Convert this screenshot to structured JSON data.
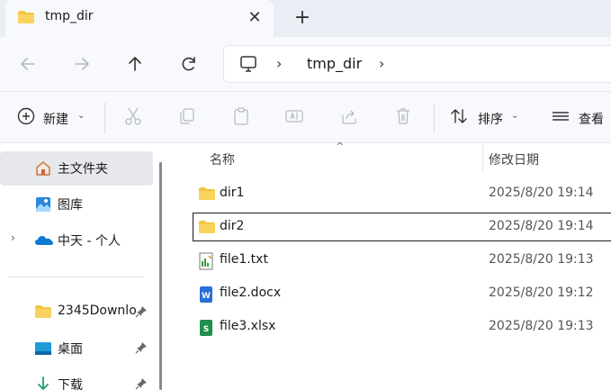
{
  "tab": {
    "title": "tmp_dir",
    "close": "✕",
    "new_tab": "+"
  },
  "address": {
    "path_segment": "tmp_dir",
    "separator": "›"
  },
  "toolbar": {
    "new_label": "新建",
    "sort_label": "排序",
    "view_label": "查看",
    "caret": "⌄"
  },
  "sidebar": {
    "items": [
      {
        "label": "主文件夹",
        "icon": "home-icon",
        "selected": true
      },
      {
        "label": "图库",
        "icon": "gallery-icon"
      },
      {
        "label": "中天 - 个人",
        "icon": "onedrive-icon",
        "expandable": true
      },
      {
        "label": "2345Downlo",
        "icon": "folder-icon",
        "pinned": true
      },
      {
        "label": "桌面",
        "icon": "desktop-icon",
        "pinned": true
      },
      {
        "label": "下载",
        "icon": "download-icon",
        "pinned": true
      }
    ],
    "chevron": "›"
  },
  "columns": {
    "name": "名称",
    "date": "修改日期",
    "sort_indicator": "^"
  },
  "files": [
    {
      "name": "dir1",
      "date": "2025/8/20 19:14",
      "icon": "folder-icon"
    },
    {
      "name": "dir2",
      "date": "2025/8/20 19:14",
      "icon": "folder-icon",
      "focused": true
    },
    {
      "name": "file1.txt",
      "date": "2025/8/20 19:13",
      "icon": "text-file-icon"
    },
    {
      "name": "file2.docx",
      "date": "2025/8/20 19:12",
      "icon": "word-file-icon"
    },
    {
      "name": "file3.xlsx",
      "date": "2025/8/20 19:13",
      "icon": "excel-file-icon"
    }
  ],
  "colors": {
    "folder": "#f4c542",
    "accent": "#0067c0",
    "word": "#2b6fd6",
    "excel": "#1f8f4e",
    "selected_bg": "#e6e8eb"
  }
}
